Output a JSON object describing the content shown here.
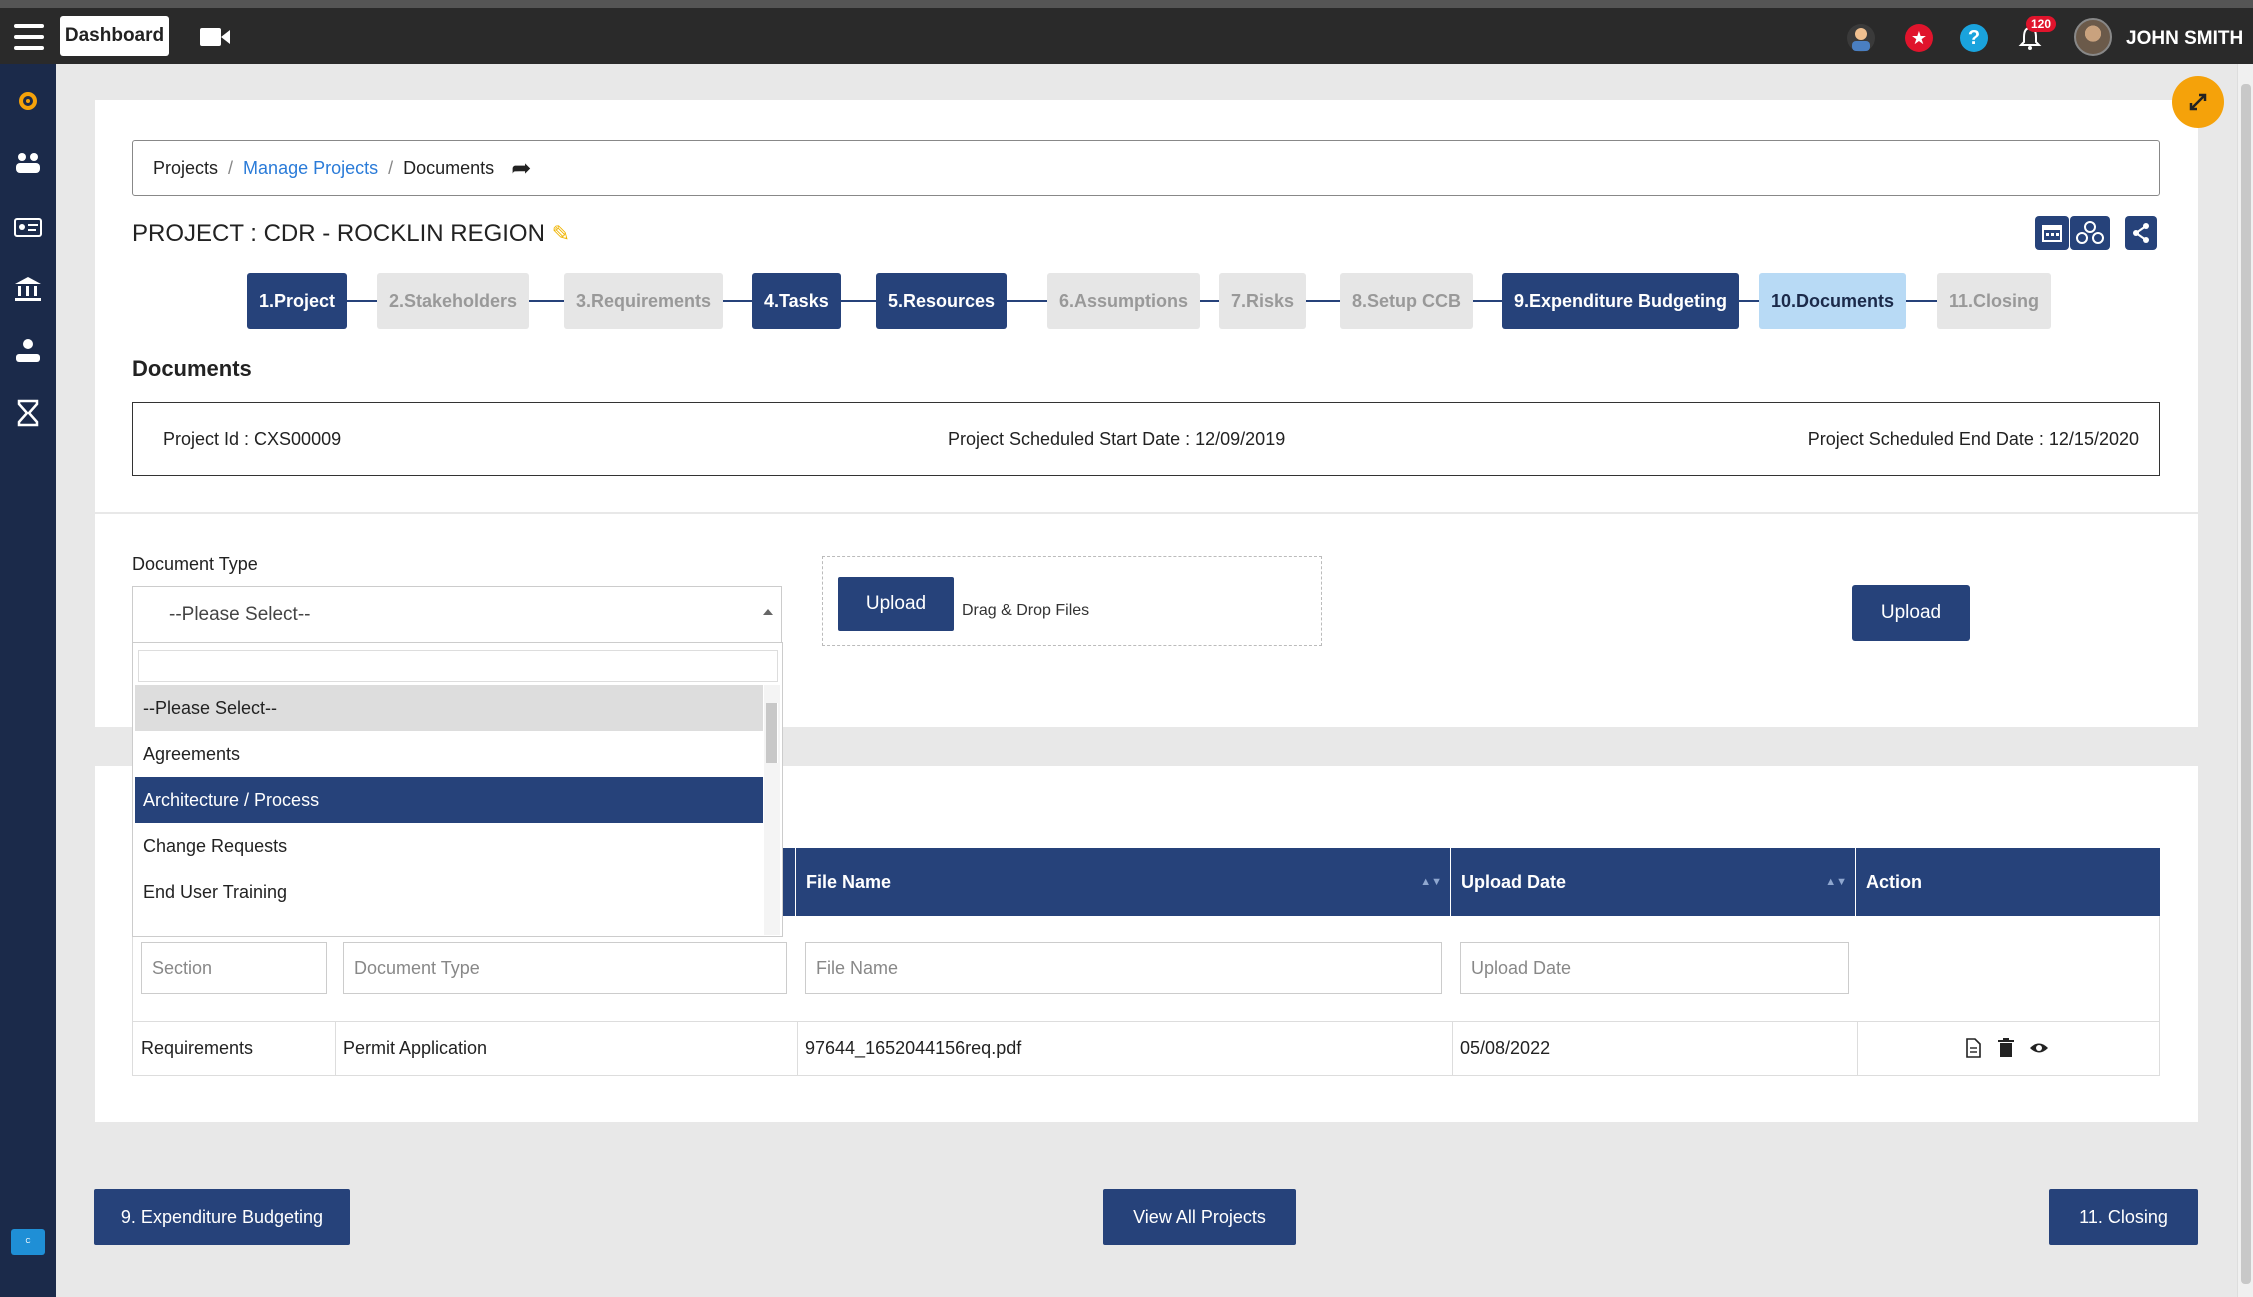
{
  "topbar": {
    "dashboard_label": "Dashboard",
    "notification_count": "120",
    "username": "JOHN SMITH"
  },
  "breadcrumb": {
    "item1": "Projects",
    "item2": "Manage Projects",
    "item3": "Documents"
  },
  "project": {
    "title": "PROJECT : CDR - ROCKLIN REGION"
  },
  "steps": [
    {
      "label": "1.Project",
      "state": "done"
    },
    {
      "label": "2.Stakeholders",
      "state": "todo"
    },
    {
      "label": "3.Requirements",
      "state": "todo"
    },
    {
      "label": "4.Tasks",
      "state": "done"
    },
    {
      "label": "5.Resources",
      "state": "done"
    },
    {
      "label": "6.Assumptions",
      "state": "todo"
    },
    {
      "label": "7.Risks",
      "state": "todo"
    },
    {
      "label": "8.Setup CCB",
      "state": "todo"
    },
    {
      "label": "9.Expenditure Budgeting",
      "state": "done"
    },
    {
      "label": "10.Documents",
      "state": "active"
    },
    {
      "label": "11.Closing",
      "state": "todo"
    }
  ],
  "documents": {
    "section_title": "Documents",
    "project_id": "Project Id : CXS00009",
    "start_date": "Project Scheduled Start Date : 12/09/2019",
    "end_date": "Project Scheduled End Date : 12/15/2020",
    "doc_type_label": "Document Type",
    "doc_type_selected": "--Please Select--",
    "upload_button": "Upload",
    "drag_drop_text": "Drag & Drop Files",
    "upload_submit": "Upload"
  },
  "dropdown": {
    "options": [
      "--Please Select--",
      "Agreements",
      "Architecture / Process",
      "Change Requests",
      "End User Training"
    ],
    "highlighted": "--Please Select--",
    "selected": "Architecture / Process"
  },
  "table": {
    "headers": {
      "file_name": "File Name",
      "upload_date": "Upload Date",
      "action": "Action"
    },
    "filters": {
      "section": "Section",
      "document_type": "Document Type",
      "file_name": "File Name",
      "upload_date": "Upload Date"
    },
    "rows": [
      {
        "section": "Requirements",
        "document_type": "Permit Application",
        "file_name": "97644_1652044156req.pdf",
        "upload_date": "05/08/2022"
      }
    ]
  },
  "footer": {
    "prev_button": "9. Expenditure Budgeting",
    "view_all_button": "View All Projects",
    "next_button": "11. Closing"
  },
  "colors": {
    "primary": "#26427a",
    "sidebar": "#1b2a4a",
    "active_step": "#b8daf5",
    "fab": "#f5a20a"
  }
}
